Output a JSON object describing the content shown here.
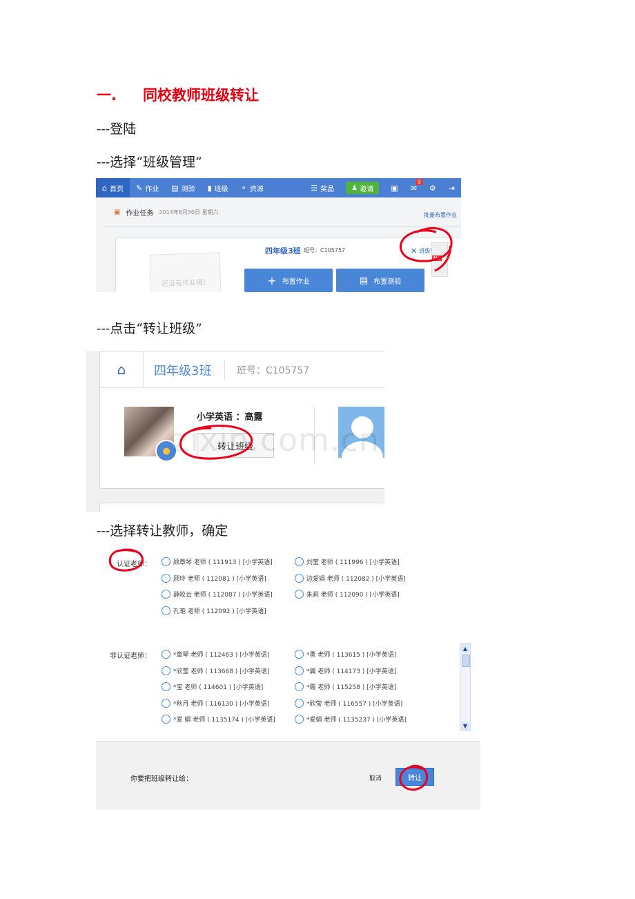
{
  "heading": {
    "number": "一.",
    "title": "同校教师班级转让"
  },
  "steps": [
    "---登陆",
    "---选择“班级管理”",
    "---点击“转让班级”",
    "---选择转让教师，确定"
  ],
  "shot1": {
    "nav": {
      "home": "首页",
      "homework": "作业",
      "quiz": "测验",
      "class": "班级",
      "resources": "资源",
      "prizes": "奖品",
      "invite": "邀请",
      "mail_badge": "9"
    },
    "task_title": "作业任务",
    "task_date": "2014年8月30日 星期六",
    "batch_link": "批量布置作业",
    "empty_text": "还没有作业哦！",
    "class_name": "四年级3班",
    "class_code": "班号：C105757",
    "manage_link": "班级管理",
    "assign_homework": "布置作业",
    "assign_quiz": "布置测验",
    "new_badge": "Ne"
  },
  "shot2": {
    "class_name": "四年级3班",
    "class_code": "班号：C105757",
    "teacher_name": "小学英语 ：高露",
    "transfer_button": "转让班级",
    "watermark": "zixin.com.cn"
  },
  "shot3": {
    "certified_label": "认证老师：",
    "certified": [
      [
        "顾章琴 老师 ( 111913 ) [小学英语]",
        "刘莹 老师 ( 111996 ) [小学英语]"
      ],
      [
        "顾玲 老师 ( 112081 ) [小学英语]",
        "边爱娟 老师 ( 112082 ) [小学英语]"
      ],
      [
        "薛皎云 老师 ( 112087 ) [小学英语]",
        "朱莉 老师 ( 112090 ) [小学英语]"
      ],
      [
        "孔艳 老师 ( 112092 ) [小学英语]",
        ""
      ]
    ],
    "uncertified_label": "非认证老师：",
    "uncertified": [
      [
        "*章琴 老师 ( 112463 ) [小学英语]",
        "*勇 老师 ( 113615 ) [小学英语]"
      ],
      [
        "*欣莹 老师 ( 113668 ) [小学英语]",
        "*翼 老师 ( 114173 ) [小学英语]"
      ],
      [
        "*宝 老师 ( 114601 ) [小学英语]",
        "*霞 老师 ( 115258 ) [小学英语]"
      ],
      [
        "*秋月 老师 ( 116130 ) [小学英语]",
        "*欣莹 老师 ( 116557 ) [小学英语]"
      ],
      [
        "*爱 娟 老师 ( 1135174 ) [小学英语]",
        "*爱娟 老师 ( 1135237 ) [小学英语]"
      ]
    ],
    "footer_question": "你要把班级转让给：",
    "cancel": "取消",
    "confirm": "转让"
  }
}
